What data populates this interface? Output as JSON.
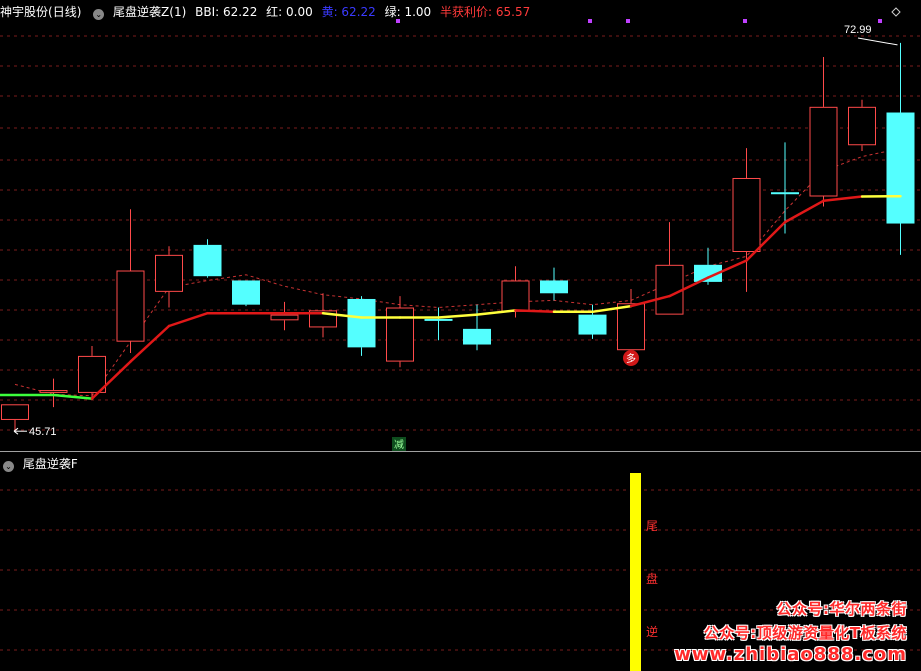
{
  "header_main": {
    "stock_name": "神宇股份",
    "period": "(日线)",
    "indicator": "尾盘逆袭Z(1)",
    "bbi": "BBI: 62.22",
    "red": "红: 0.00",
    "yellow": "黄: 62.22",
    "green": "绿: 1.00",
    "half_profit": "半获利价: 65.57"
  },
  "header_sub": {
    "indicator": "尾盘逆袭F"
  },
  "annotations": {
    "high_label": "72.99",
    "low_label": "45.71",
    "buy_marker": "多",
    "reduce_marker": "减",
    "sub_chars": [
      "尾",
      "盘",
      "逆"
    ]
  },
  "watermark": {
    "line1": "公众号:华尔两条街",
    "line2": "公众号:顶级游资量化T板系统",
    "line3": "www.zhibiao888.com"
  },
  "colors": {
    "up": "#ff4a4a",
    "down": "#54ffff",
    "bbi": "#e01818",
    "yellow": "#ffff3c",
    "green": "#3cff3c",
    "half_profit": "#c83232",
    "grid": "#7a1c1c",
    "sub_bar": "#ffff00"
  },
  "chart_data": {
    "type": "candlestick",
    "price_range": [
      44.6,
      74.6
    ],
    "candles": [
      {
        "o": 46.5,
        "h": 47.6,
        "l": 45.71,
        "c": 47.6,
        "dir": "up"
      },
      {
        "o": 48.4,
        "h": 49.4,
        "l": 47.4,
        "c": 48.6,
        "dir": "up"
      },
      {
        "o": 48.4,
        "h": 51.7,
        "l": 48.0,
        "c": 51.0,
        "dir": "up"
      },
      {
        "o": 52.0,
        "h": 61.3,
        "l": 51.2,
        "c": 57.0,
        "dir": "up"
      },
      {
        "o": 55.5,
        "h": 58.7,
        "l": 54.4,
        "c": 58.1,
        "dir": "up"
      },
      {
        "o": 58.8,
        "h": 59.2,
        "l": 56.5,
        "c": 56.6,
        "dir": "down"
      },
      {
        "o": 56.3,
        "h": 56.3,
        "l": 54.5,
        "c": 54.6,
        "dir": "down"
      },
      {
        "o": 53.5,
        "h": 54.8,
        "l": 52.8,
        "c": 53.9,
        "dir": "up"
      },
      {
        "o": 53.0,
        "h": 55.4,
        "l": 52.3,
        "c": 54.2,
        "dir": "up"
      },
      {
        "o": 55.0,
        "h": 55.2,
        "l": 51.0,
        "c": 51.6,
        "dir": "down"
      },
      {
        "o": 50.6,
        "h": 55.2,
        "l": 50.2,
        "c": 54.4,
        "dir": "up"
      },
      {
        "o": 53.6,
        "h": 54.4,
        "l": 52.1,
        "c": 53.6,
        "dir": "down"
      },
      {
        "o": 52.9,
        "h": 54.6,
        "l": 51.4,
        "c": 51.8,
        "dir": "down"
      },
      {
        "o": 54.1,
        "h": 57.3,
        "l": 53.7,
        "c": 56.3,
        "dir": "up"
      },
      {
        "o": 56.3,
        "h": 57.2,
        "l": 54.9,
        "c": 55.4,
        "dir": "down"
      },
      {
        "o": 53.9,
        "h": 54.6,
        "l": 52.2,
        "c": 52.5,
        "dir": "down"
      },
      {
        "o": 51.4,
        "h": 55.7,
        "l": 51.1,
        "c": 54.7,
        "dir": "up"
      },
      {
        "o": 53.9,
        "h": 60.4,
        "l": 53.9,
        "c": 57.4,
        "dir": "up"
      },
      {
        "o": 57.4,
        "h": 58.6,
        "l": 56.0,
        "c": 56.2,
        "dir": "down"
      },
      {
        "o": 58.3,
        "h": 65.6,
        "l": 55.5,
        "c": 63.5,
        "dir": "up"
      },
      {
        "o": 62.5,
        "h": 66.0,
        "l": 59.6,
        "c": 62.5,
        "dir": "down"
      },
      {
        "o": 62.2,
        "h": 72.0,
        "l": 61.5,
        "c": 68.5,
        "dir": "up"
      },
      {
        "o": 68.5,
        "h": 69.0,
        "l": 65.4,
        "c": 65.8,
        "dir": "up"
      },
      {
        "o": 68.1,
        "h": 72.99,
        "l": 58.1,
        "c": 60.3,
        "dir": "down"
      }
    ],
    "bbi_line": [
      null,
      48.25,
      48.0,
      50.6,
      53.1,
      54.0,
      54.0,
      54.0,
      54.0,
      53.7,
      53.7,
      53.7,
      53.9,
      54.2,
      54.1,
      54.1,
      54.5,
      55.2,
      56.5,
      57.7,
      60.4,
      61.9,
      62.2,
      62.22
    ],
    "half_profit_line": [
      49.0,
      48.3,
      48.2,
      52.0,
      55.8,
      56.3,
      56.7,
      55.9,
      55.3,
      55.0,
      54.6,
      54.4,
      54.6,
      54.8,
      54.9,
      54.6,
      54.9,
      56.1,
      57.3,
      58.0,
      61.2,
      64.0,
      65.0,
      65.57
    ],
    "sub_panel": {
      "type": "bar",
      "bar_index": 16,
      "range": [
        0,
        1
      ]
    }
  }
}
